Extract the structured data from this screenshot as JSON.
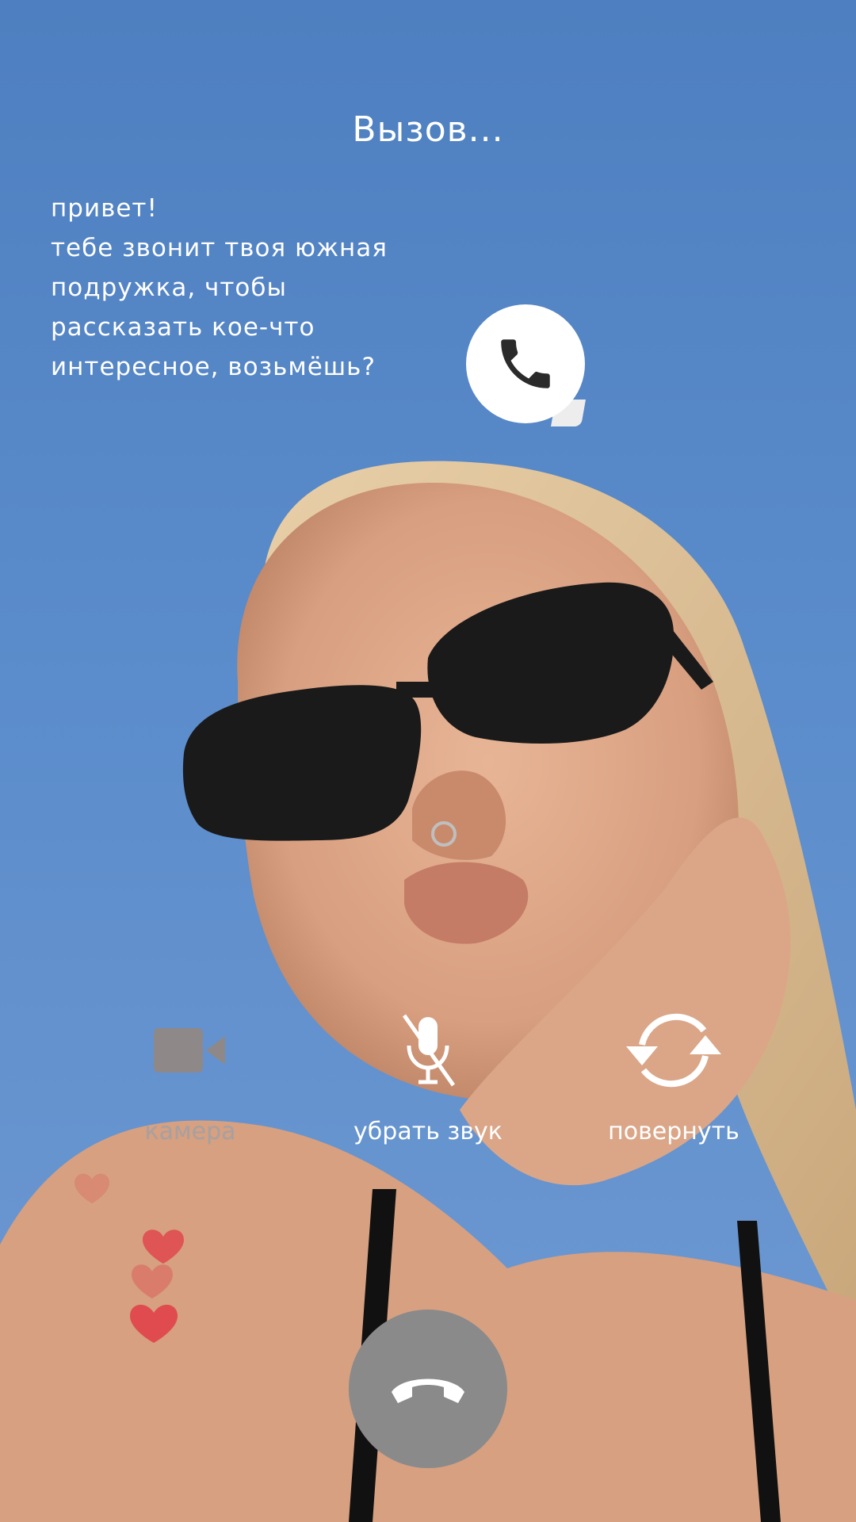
{
  "call": {
    "status": "Вызов..."
  },
  "message": {
    "lines": [
      "привет!",
      "тебе звонит твоя южная",
      "подружка, чтобы",
      "рассказать кое-что",
      "интересное, возьмёшь?"
    ]
  },
  "controls": {
    "camera_label": "камера",
    "mute_label": "убрать звук",
    "rotate_label": "повернуть"
  },
  "icons": {
    "incoming": "phone-icon",
    "camera": "video-camera-icon",
    "mute": "microphone-muted-icon",
    "rotate": "rotate-camera-icon",
    "hearts": "heart-icon",
    "end_call": "hang-up-icon"
  },
  "colors": {
    "sky": "#5b8ccb",
    "end_call_button": "#8a8a8a",
    "hearts": "#e0474c",
    "camera_inactive": "#a7a0a0"
  }
}
